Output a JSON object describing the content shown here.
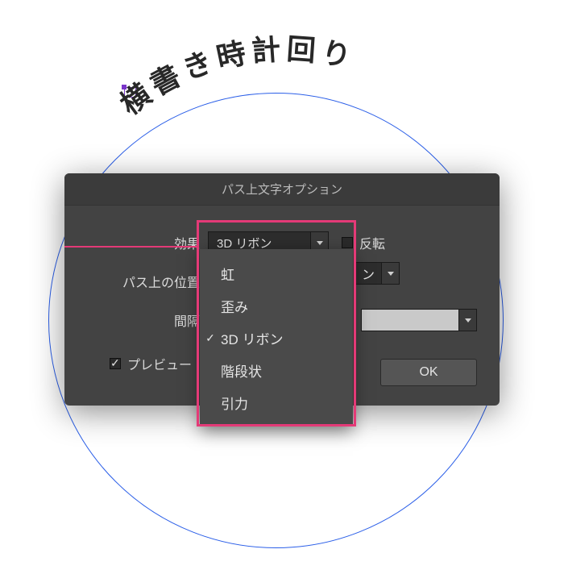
{
  "canvas": {
    "path_text": "横書き時計回り"
  },
  "dialog": {
    "title": "パス上文字オプション",
    "rows": {
      "effect_label": "効果",
      "effect_value": "3D リボン",
      "flip_label": "反転",
      "position_label": "パス上の位置",
      "position_value_tail": "ン",
      "spacing_label": "間隔"
    },
    "dropdown_options": {
      "opt0": "虹",
      "opt1": "歪み",
      "opt2": "3D リボン",
      "opt3": "階段状",
      "opt4": "引力"
    },
    "dropdown_selected_index": 2,
    "preview_label": "プレビュー",
    "preview_checked": true,
    "ok_label": "OK"
  }
}
